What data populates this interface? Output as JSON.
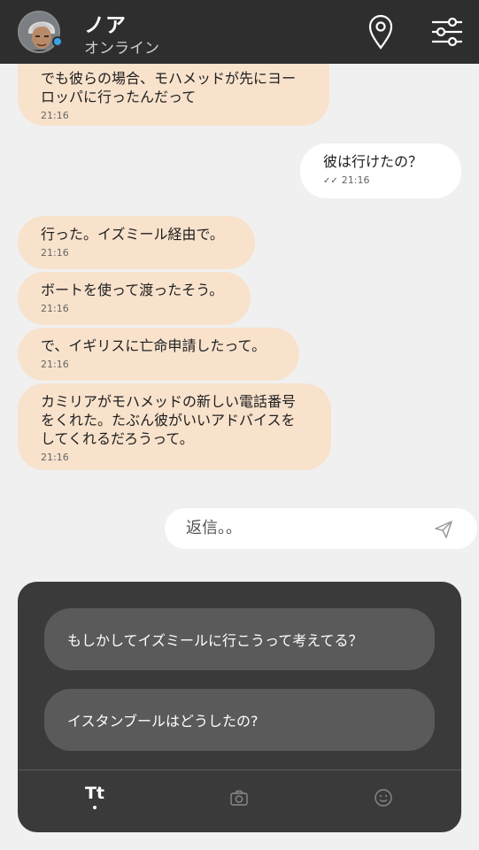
{
  "header": {
    "name": "ノア",
    "status": "オンライン",
    "location_icon": "map-pin-icon",
    "settings_icon": "sliders-icon"
  },
  "messages": [
    {
      "dir": "in",
      "text": "でも彼らの場合、モハメッドが先にヨー\nロッパに行ったんだって",
      "time": "21:16"
    },
    {
      "dir": "out",
      "text": "彼は行けたの？",
      "time": "21:16"
    },
    {
      "dir": "in",
      "text": "行った。イズミール経由で。",
      "time": "21:16"
    },
    {
      "dir": "in",
      "text": "ボートを使って渡ったそう。",
      "time": "21:16"
    },
    {
      "dir": "in",
      "text": "で、イギリスに亡命申請したって。",
      "time": "21:16"
    },
    {
      "dir": "in",
      "text": "カミリアがモハメッドの新しい電話番号\nをくれた。たぶん彼がいいアドバイスを\nしてくれるだろうって。",
      "time": "21:16"
    }
  ],
  "reply": {
    "placeholder": "返信。。"
  },
  "suggestions": [
    "もしかしてイズミールに行こうって考えてる？",
    "イスタンブールはどうしたの?"
  ],
  "tabs": {
    "text_label": "Tt",
    "camera_icon": "camera-icon",
    "emoji_icon": "smiley-icon"
  },
  "colors": {
    "header_bg": "#2e2e2e",
    "incoming_bubble": "#f8e2cc",
    "outgoing_bubble": "#ffffff",
    "panel_bg": "#3a3a3a",
    "suggestion_bg": "#5a5a5a",
    "online_dot": "#3aa3e6"
  }
}
